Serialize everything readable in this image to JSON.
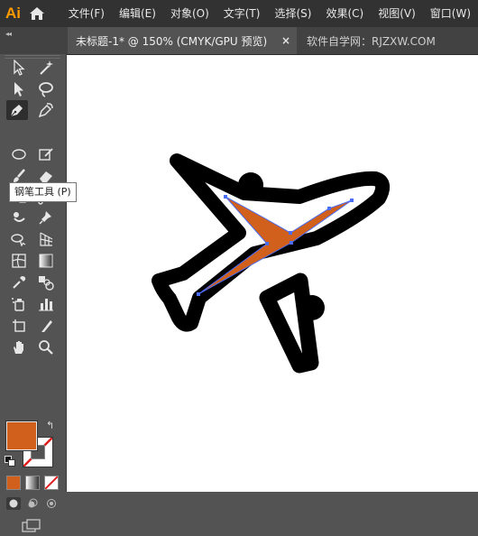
{
  "app": {
    "logo": "Ai"
  },
  "menu": {
    "items": [
      "文件(F)",
      "编辑(E)",
      "对象(O)",
      "文字(T)",
      "选择(S)",
      "效果(C)",
      "视图(V)",
      "窗口(W)"
    ]
  },
  "tabs": {
    "active_label": "未标题-1* @ 150% (CMYK/GPU 预览)",
    "close_glyph": "×",
    "inactive_label": "软件自学网：RJZXW.COM"
  },
  "toolbar": {
    "collapse_glyph": "◂◂",
    "tooltip": "钢笔工具 (P)",
    "swap_glyph": "↰"
  },
  "colors": {
    "fill": "#d0601b",
    "stroke": "#ffffff",
    "selection_blue": "#4a6cf7",
    "ui_dark": "#323232",
    "ui_mid": "#535353"
  },
  "icons": {
    "home": "home-icon",
    "close": "close-icon",
    "selection": "selection-tool-icon",
    "direct_selection": "direct-selection-tool-icon",
    "pen": "pen-tool-icon",
    "brush": "paintbrush-tool-icon"
  }
}
